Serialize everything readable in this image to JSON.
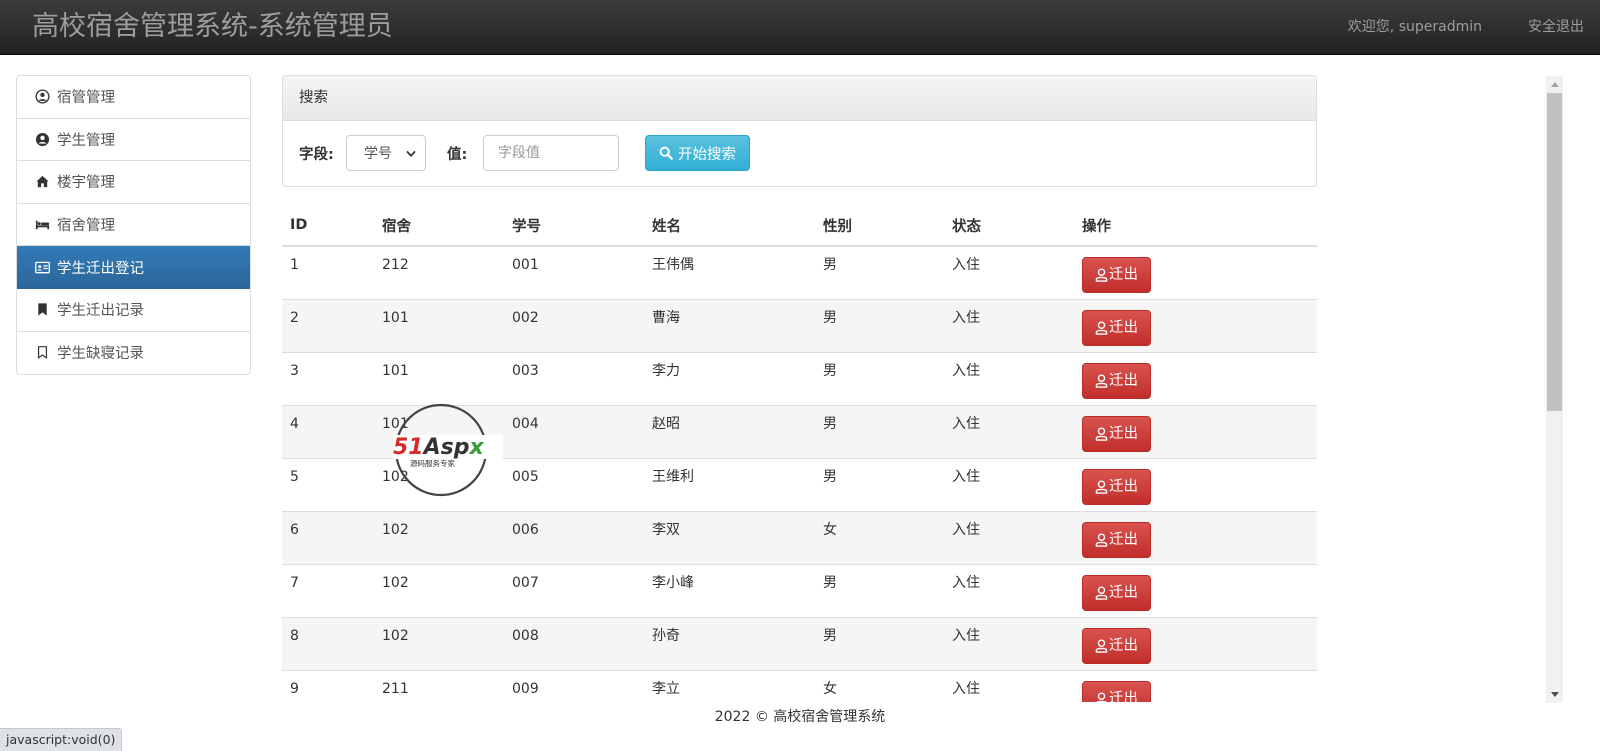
{
  "header": {
    "brand": "高校宿舍管理系统-系统管理员",
    "welcome": "欢迎您, superadmin",
    "logout": "安全退出"
  },
  "sidebar": {
    "items": [
      {
        "label": "宿管管理",
        "icon": "user-circle-icon"
      },
      {
        "label": "学生管理",
        "icon": "user-circle-filled-icon"
      },
      {
        "label": "楼宇管理",
        "icon": "home-icon"
      },
      {
        "label": "宿舍管理",
        "icon": "bed-icon"
      },
      {
        "label": "学生迁出登记",
        "icon": "id-card-icon",
        "active": true
      },
      {
        "label": "学生迁出记录",
        "icon": "bookmark-icon"
      },
      {
        "label": "学生缺寝记录",
        "icon": "bookmark-outline-icon"
      }
    ]
  },
  "search": {
    "panel_title": "搜索",
    "field_label": "字段:",
    "field_selected": "学号",
    "value_label": "值:",
    "value_placeholder": "字段值",
    "value": "",
    "button_label": "开始搜索"
  },
  "table": {
    "columns": [
      "ID",
      "宿舍",
      "学号",
      "姓名",
      "性别",
      "状态",
      "操作"
    ],
    "action_label": "迁出",
    "rows": [
      {
        "id": "1",
        "dorm": "212",
        "num": "001",
        "name": "王伟偶",
        "sex": "男",
        "status": "入住"
      },
      {
        "id": "2",
        "dorm": "101",
        "num": "002",
        "name": "曹海",
        "sex": "男",
        "status": "入住"
      },
      {
        "id": "3",
        "dorm": "101",
        "num": "003",
        "name": "李力",
        "sex": "男",
        "status": "入住"
      },
      {
        "id": "4",
        "dorm": "101",
        "num": "004",
        "name": "赵昭",
        "sex": "男",
        "status": "入住"
      },
      {
        "id": "5",
        "dorm": "102",
        "num": "005",
        "name": "王维利",
        "sex": "男",
        "status": "入住"
      },
      {
        "id": "6",
        "dorm": "102",
        "num": "006",
        "name": "李双",
        "sex": "女",
        "status": "入住"
      },
      {
        "id": "7",
        "dorm": "102",
        "num": "007",
        "name": "李小峰",
        "sex": "男",
        "status": "入住"
      },
      {
        "id": "8",
        "dorm": "102",
        "num": "008",
        "name": "孙奇",
        "sex": "男",
        "status": "入住"
      },
      {
        "id": "9",
        "dorm": "211",
        "num": "009",
        "name": "李立",
        "sex": "女",
        "status": "入住"
      }
    ]
  },
  "watermark": {
    "logo": "51Aspx",
    "tagline": "源码服务专家"
  },
  "footer": {
    "text": "2022 © 高校宿舍管理系统"
  },
  "statusbar": {
    "text": "javascript:void(0)"
  },
  "colors": {
    "navbar": "#222222",
    "active": "#337ab7",
    "info": "#5bc0de",
    "danger": "#d9534f"
  }
}
